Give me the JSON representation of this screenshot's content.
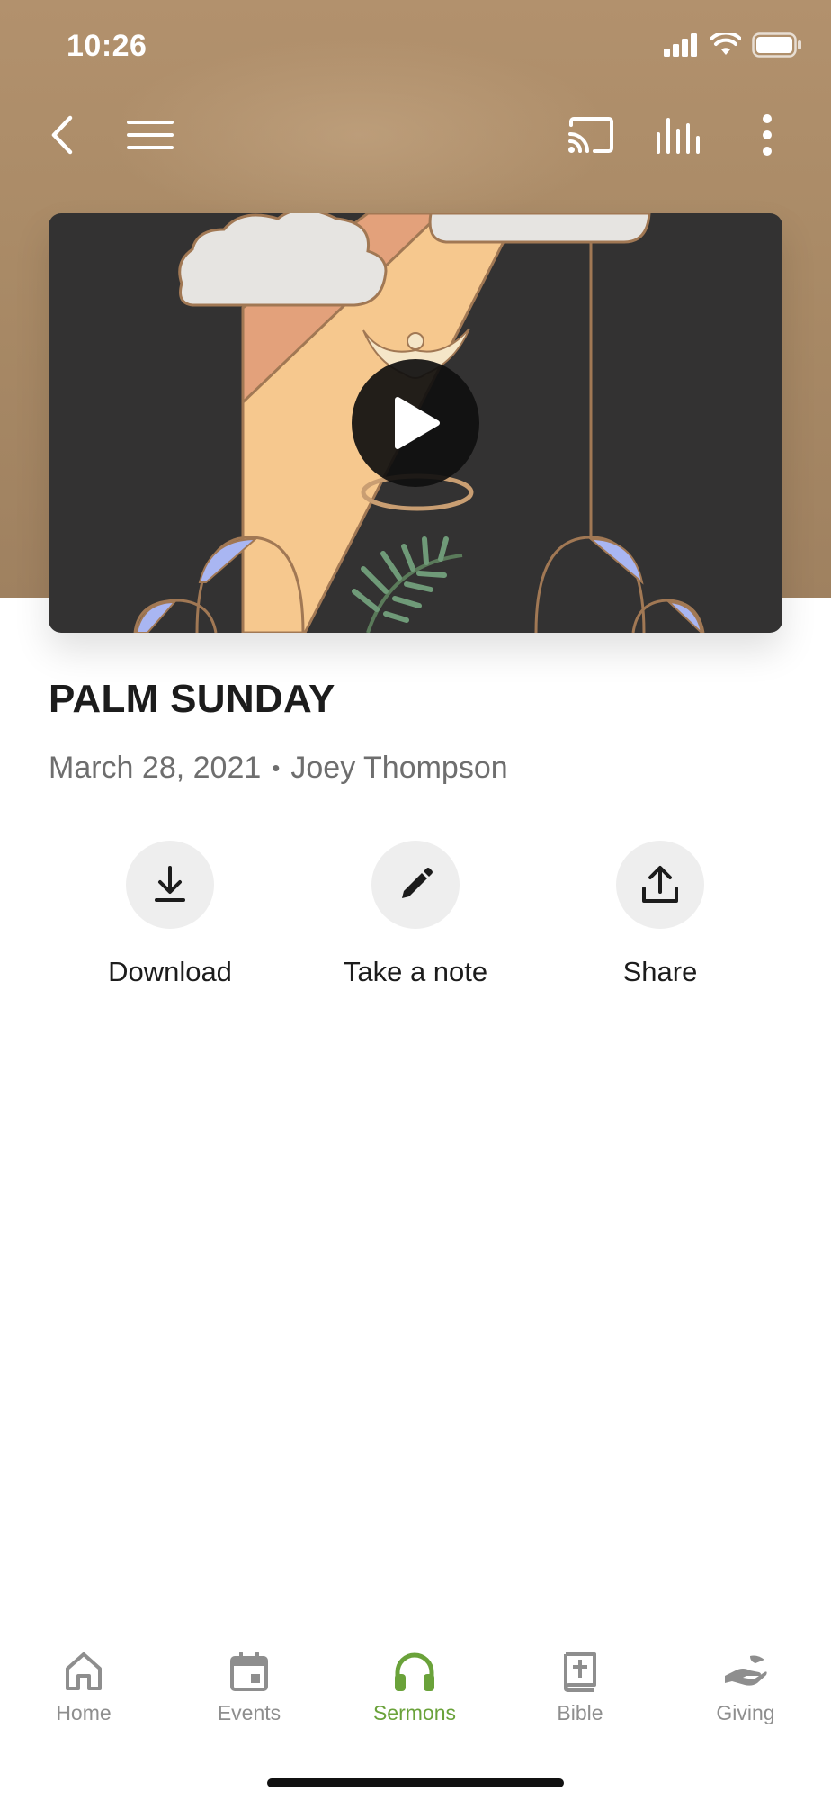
{
  "status_bar": {
    "time": "10:26"
  },
  "toolbar": {
    "back_icon": "chevron-left-icon",
    "menu_icon": "hamburger-menu-icon",
    "cast_icon": "cast-icon",
    "audio_icon": "audio-bars-icon",
    "more_icon": "vertical-more-icon"
  },
  "sermon": {
    "title": "PALM SUNDAY",
    "date": "March 28, 2021",
    "separator": "•",
    "speaker": "Joey Thompson"
  },
  "actions": [
    {
      "label": "Download",
      "icon": "download-icon"
    },
    {
      "label": "Take a note",
      "icon": "pencil-icon"
    },
    {
      "label": "Share",
      "icon": "share-icon"
    }
  ],
  "tabs": [
    {
      "label": "Home",
      "icon": "home-icon"
    },
    {
      "label": "Events",
      "icon": "calendar-icon"
    },
    {
      "label": "Sermons",
      "icon": "headphones-icon",
      "active": true
    },
    {
      "label": "Bible",
      "icon": "bible-icon"
    },
    {
      "label": "Giving",
      "icon": "giving-hand-icon"
    }
  ],
  "colors": {
    "header_bg": "#a98a66",
    "accent_active": "#6aa23a",
    "tab_inactive": "#8e8e8e",
    "video_bg": "#333232"
  }
}
